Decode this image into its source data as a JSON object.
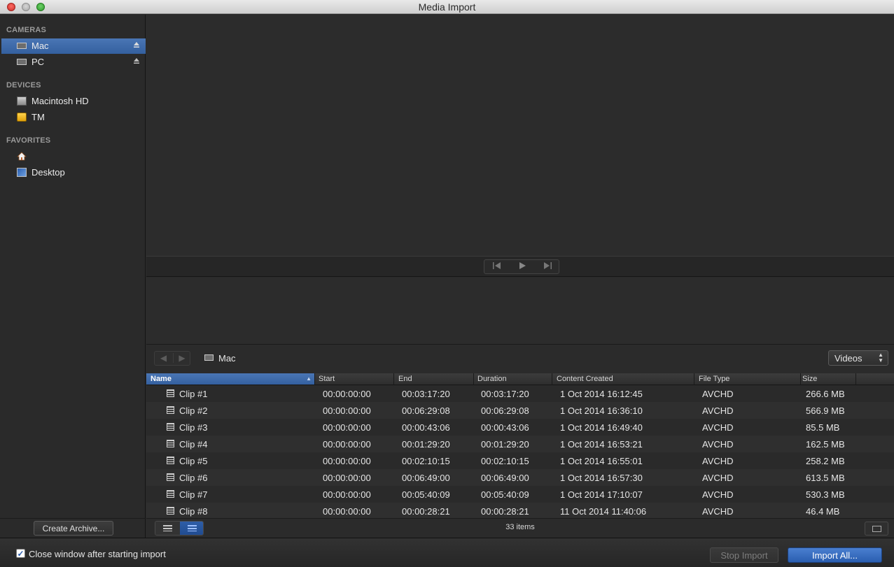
{
  "window": {
    "title": "Media Import"
  },
  "sidebar": {
    "cameras_heading": "CAMERAS",
    "cameras": [
      {
        "label": "Mac",
        "icon": "camera-icon",
        "selected": true
      },
      {
        "label": "PC",
        "icon": "camera-icon",
        "selected": false
      }
    ],
    "devices_heading": "DEVICES",
    "devices": [
      {
        "label": "Macintosh HD",
        "icon": "hard-drive-icon"
      },
      {
        "label": "TM",
        "icon": "external-drive-icon"
      }
    ],
    "favorites_heading": "FAVORITES",
    "favorites": [
      {
        "label": "",
        "icon": "home-icon"
      },
      {
        "label": "Desktop",
        "icon": "desktop-folder-icon"
      }
    ],
    "create_archive_label": "Create Archive..."
  },
  "browser": {
    "breadcrumb": "Mac",
    "filter_value": "Videos",
    "columns": [
      "Name",
      "Start",
      "End",
      "Duration",
      "Content Created",
      "File Type",
      "Size"
    ],
    "sorted_column": "Name",
    "rows": [
      [
        "Clip #1",
        "00:00:00:00",
        "00:03:17:20",
        "00:03:17:20",
        "1 Oct 2014 16:12:45",
        "AVCHD",
        "266.6 MB"
      ],
      [
        "Clip #2",
        "00:00:00:00",
        "00:06:29:08",
        "00:06:29:08",
        "1 Oct 2014 16:36:10",
        "AVCHD",
        "566.9 MB"
      ],
      [
        "Clip #3",
        "00:00:00:00",
        "00:00:43:06",
        "00:00:43:06",
        "1 Oct 2014 16:49:40",
        "AVCHD",
        "85.5 MB"
      ],
      [
        "Clip #4",
        "00:00:00:00",
        "00:01:29:20",
        "00:01:29:20",
        "1 Oct 2014 16:53:21",
        "AVCHD",
        "162.5 MB"
      ],
      [
        "Clip #5",
        "00:00:00:00",
        "00:02:10:15",
        "00:02:10:15",
        "1 Oct 2014 16:55:01",
        "AVCHD",
        "258.2 MB"
      ],
      [
        "Clip #6",
        "00:00:00:00",
        "00:06:49:00",
        "00:06:49:00",
        "1 Oct 2014 16:57:30",
        "AVCHD",
        "613.5 MB"
      ],
      [
        "Clip #7",
        "00:00:00:00",
        "00:05:40:09",
        "00:05:40:09",
        "1 Oct 2014 17:10:07",
        "AVCHD",
        "530.3 MB"
      ],
      [
        "Clip #8",
        "00:00:00:00",
        "00:00:28:21",
        "00:00:28:21",
        "11 Oct 2014 11:40:06",
        "AVCHD",
        "46.4 MB"
      ]
    ],
    "item_count": "33 items"
  },
  "footer": {
    "close_window_label": "Close window after starting import",
    "close_window_checked": true,
    "stop_import_label": "Stop Import",
    "import_all_label": "Import All..."
  },
  "colors": {
    "selection": "#3d6aab",
    "accent_button": "#2a5eb0"
  }
}
